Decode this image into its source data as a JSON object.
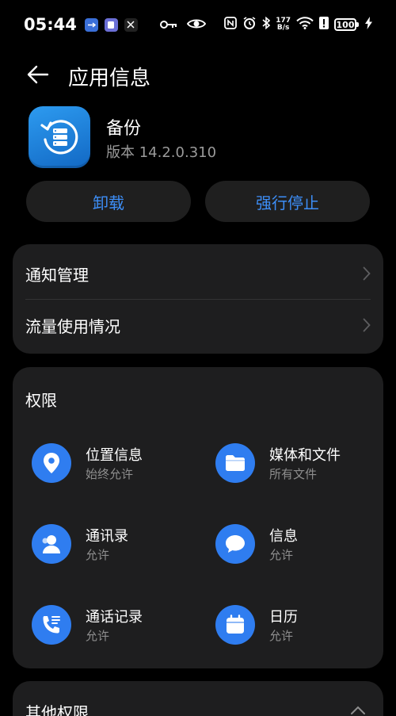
{
  "status_bar": {
    "time": "05:44",
    "net_speed_value": "177",
    "net_speed_unit": "B/s",
    "battery": "100"
  },
  "header": {
    "title": "应用信息"
  },
  "app": {
    "name": "备份",
    "version": "版本 14.2.0.310"
  },
  "actions": {
    "uninstall": "卸载",
    "force_stop": "强行停止"
  },
  "settings": {
    "notifications": "通知管理",
    "data_usage": "流量使用情况"
  },
  "permissions": {
    "title": "权限",
    "items": [
      {
        "name": "位置信息",
        "state": "始终允许",
        "icon": "location-icon"
      },
      {
        "name": "媒体和文件",
        "state": "所有文件",
        "icon": "folder-icon"
      },
      {
        "name": "通讯录",
        "state": "允许",
        "icon": "contacts-icon"
      },
      {
        "name": "信息",
        "state": "允许",
        "icon": "message-icon"
      },
      {
        "name": "通话记录",
        "state": "允许",
        "icon": "call-log-icon"
      },
      {
        "name": "日历",
        "state": "允许",
        "icon": "calendar-icon"
      }
    ]
  },
  "other_permissions": {
    "title": "其他权限"
  },
  "colors": {
    "background": "#000000",
    "card": "#1e1e1f",
    "accent": "#3d8ef7",
    "icon_blue": "#2f7df0",
    "secondary_text": "#9a9a9a"
  }
}
